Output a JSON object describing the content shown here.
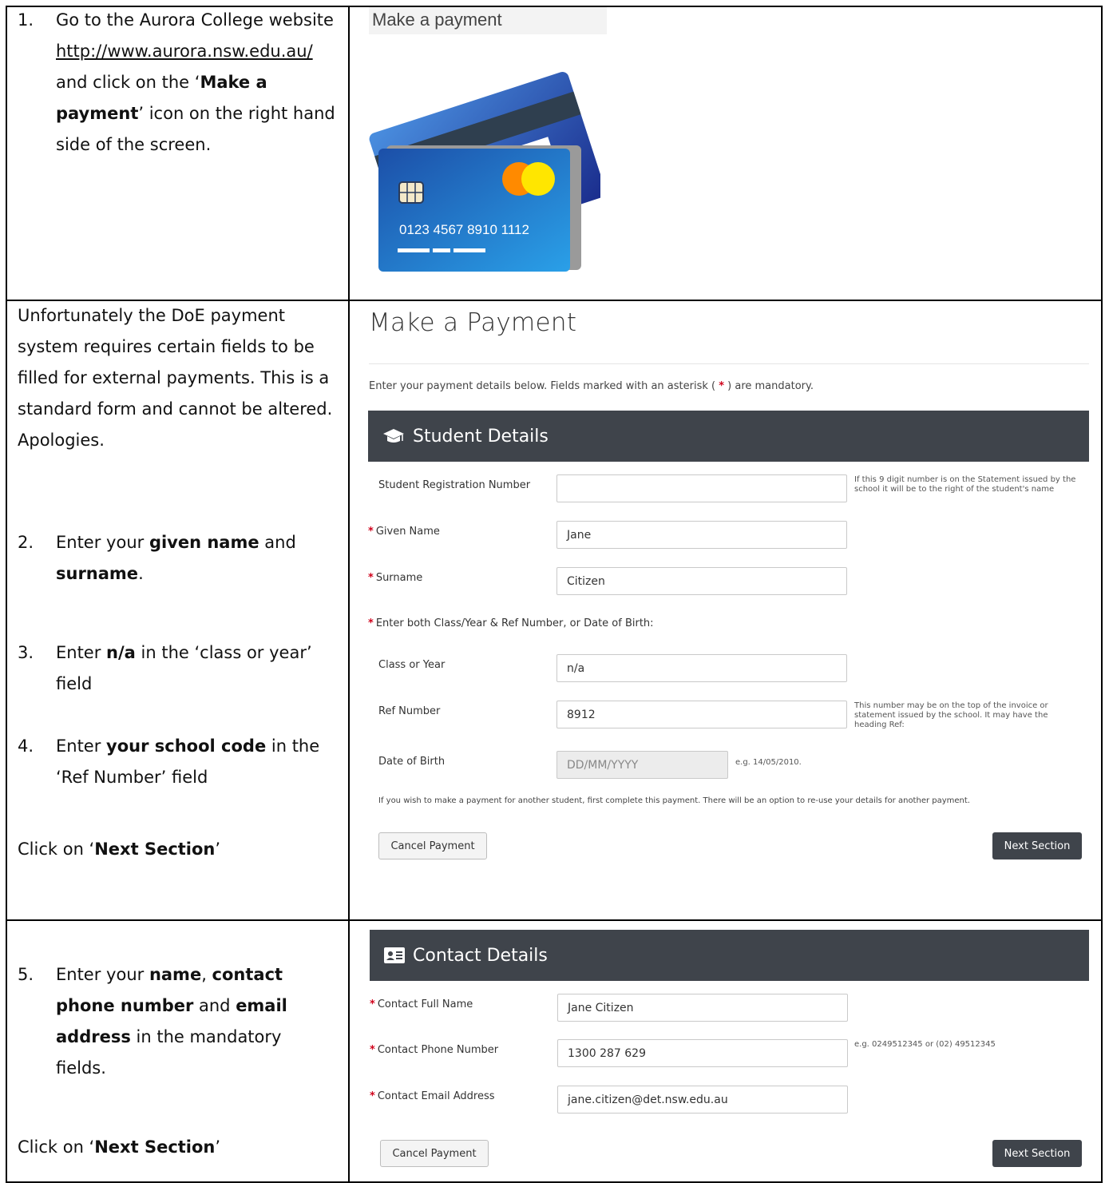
{
  "row1": {
    "step_num": "1.",
    "text_a": "Go to the Aurora College website ",
    "link": "http://www.aurora.nsw.edu.au/",
    "text_b": " and click on the ‘",
    "bold_a": "Make a payment",
    "text_c": "’ icon on the right hand side of the screen.",
    "make_payment_label": "Make a payment",
    "card": {
      "number": "0123  4567  8910  1112",
      "colors": {
        "front": "#1f6fc4",
        "back": "#2448a8",
        "chip": "#f3e9c9",
        "circle1": "#ff8a00",
        "circle2": "#ffe600"
      }
    }
  },
  "row2": {
    "intro_text": "Unfortunately the DoE payment system requires certain fields to be filled for external payments. This is a standard form and cannot be altered. Apologies.",
    "step2": {
      "num": "2.",
      "a": "Enter your ",
      "b1": "given name",
      "c": " and ",
      "b2": "surname",
      "d": "."
    },
    "step3": {
      "num": "3.",
      "a": "Enter ",
      "b": "n/a",
      "c": " in the ‘class or year’ field"
    },
    "step4": {
      "num": "4.",
      "a": "Enter ",
      "b": "your school code",
      "c": " in the ‘Ref Number’ field"
    },
    "click": {
      "a": "Click on ‘",
      "b": "Next Section",
      "c": "’"
    },
    "form": {
      "title": "Make a Payment",
      "intro_a": "Enter your payment details below. Fields marked with an asterisk ( ",
      "intro_star": "*",
      "intro_b": " ) are mandatory.",
      "panel_title": "Student Details",
      "srn_label": "Student Registration Number",
      "srn_value": "",
      "srn_hint": "If this 9 digit number is on the Statement issued by the school it will be to the right of the student's name",
      "given_label": "Given Name",
      "given_value": "Jane",
      "surname_label": "Surname",
      "surname_value": "Citizen",
      "either_label": "Enter both Class/Year & Ref Number, or Date of Birth:",
      "class_label": "Class or Year",
      "class_value": "n/a",
      "ref_label": "Ref Number",
      "ref_value": "8912",
      "ref_hint": "This number may be on the top of the invoice or statement issued by the school. It may have the heading Ref:",
      "dob_label": "Date of Birth",
      "dob_placeholder": "DD/MM/YYYY",
      "dob_hint": "e.g. 14/05/2010.",
      "note": "If you wish to make a payment for another student, first complete this payment. There will be an option to re-use your details for another payment.",
      "cancel": "Cancel Payment",
      "next": "Next Section",
      "colors": {
        "panel": "#3f444b",
        "required": "#d0021b"
      }
    }
  },
  "row3": {
    "step5": {
      "num": "5.",
      "a": "Enter your ",
      "b1": "name",
      "c": ", ",
      "b2": "contact phone number",
      "d": " and ",
      "b3": "email address",
      "e": " in the mandatory fields."
    },
    "click": {
      "a": "Click on ‘",
      "b": "Next Section",
      "c": "’"
    },
    "form": {
      "panel_title": "Contact Details",
      "name_label": "Contact Full Name",
      "name_value": "Jane Citizen",
      "phone_label": "Contact Phone Number",
      "phone_value": "1300 287 629",
      "phone_hint": "e.g. 0249512345 or (02) 49512345",
      "email_label": "Contact Email Address",
      "email_value": "jane.citizen@det.nsw.edu.au",
      "cancel": "Cancel Payment",
      "next": "Next Section"
    }
  }
}
